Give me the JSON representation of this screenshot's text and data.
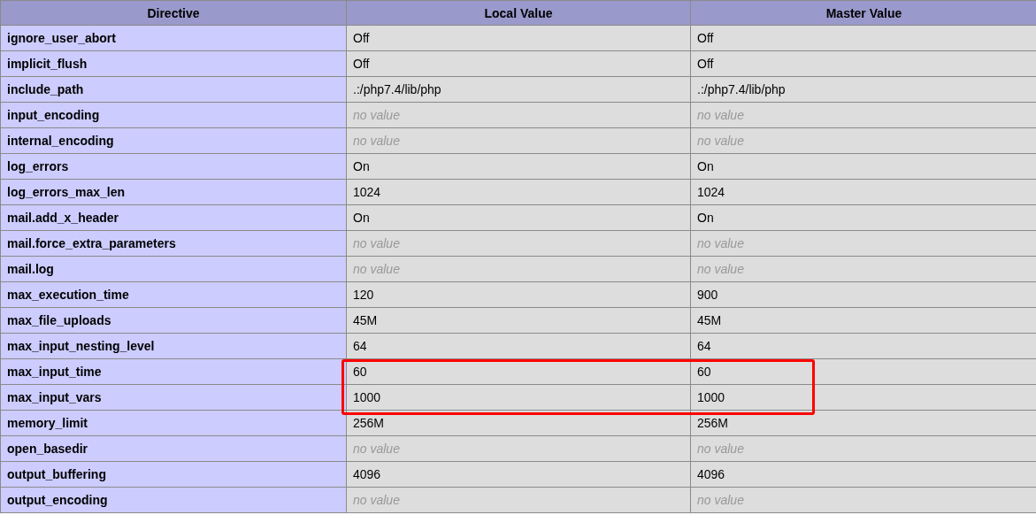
{
  "table": {
    "columns": [
      "Directive",
      "Local Value",
      "Master Value"
    ],
    "rows": [
      {
        "directive": "ignore_user_abort",
        "highlighted": false,
        "values": [
          {
            "text": "Off",
            "empty": false
          },
          {
            "text": "Off",
            "empty": false
          }
        ]
      },
      {
        "directive": "implicit_flush",
        "highlighted": false,
        "values": [
          {
            "text": "Off",
            "empty": false
          },
          {
            "text": "Off",
            "empty": false
          }
        ]
      },
      {
        "directive": "include_path",
        "highlighted": false,
        "values": [
          {
            "text": ".:/php7.4/lib/php",
            "empty": false
          },
          {
            "text": ".:/php7.4/lib/php",
            "empty": false
          }
        ]
      },
      {
        "directive": "input_encoding",
        "highlighted": false,
        "values": [
          {
            "text": "no value",
            "empty": true
          },
          {
            "text": "no value",
            "empty": true
          }
        ]
      },
      {
        "directive": "internal_encoding",
        "highlighted": false,
        "values": [
          {
            "text": "no value",
            "empty": true
          },
          {
            "text": "no value",
            "empty": true
          }
        ]
      },
      {
        "directive": "log_errors",
        "highlighted": false,
        "values": [
          {
            "text": "On",
            "empty": false
          },
          {
            "text": "On",
            "empty": false
          }
        ]
      },
      {
        "directive": "log_errors_max_len",
        "highlighted": false,
        "values": [
          {
            "text": "1024",
            "empty": false
          },
          {
            "text": "1024",
            "empty": false
          }
        ]
      },
      {
        "directive": "mail.add_x_header",
        "highlighted": false,
        "values": [
          {
            "text": "On",
            "empty": false
          },
          {
            "text": "On",
            "empty": false
          }
        ]
      },
      {
        "directive": "mail.force_extra_parameters",
        "highlighted": false,
        "values": [
          {
            "text": "no value",
            "empty": true
          },
          {
            "text": "no value",
            "empty": true
          }
        ]
      },
      {
        "directive": "mail.log",
        "highlighted": false,
        "values": [
          {
            "text": "no value",
            "empty": true
          },
          {
            "text": "no value",
            "empty": true
          }
        ]
      },
      {
        "directive": "max_execution_time",
        "highlighted": false,
        "values": [
          {
            "text": "120",
            "empty": false
          },
          {
            "text": "900",
            "empty": false
          }
        ]
      },
      {
        "directive": "max_file_uploads",
        "highlighted": false,
        "values": [
          {
            "text": "45M",
            "empty": false
          },
          {
            "text": "45M",
            "empty": false
          }
        ]
      },
      {
        "directive": "max_input_nesting_level",
        "highlighted": false,
        "values": [
          {
            "text": "64",
            "empty": false
          },
          {
            "text": "64",
            "empty": false
          }
        ]
      },
      {
        "directive": "max_input_time",
        "highlighted": true,
        "values": [
          {
            "text": "60",
            "empty": false
          },
          {
            "text": "60",
            "empty": false
          }
        ]
      },
      {
        "directive": "max_input_vars",
        "highlighted": true,
        "values": [
          {
            "text": "1000",
            "empty": false
          },
          {
            "text": "1000",
            "empty": false
          }
        ]
      },
      {
        "directive": "memory_limit",
        "highlighted": false,
        "values": [
          {
            "text": "256M",
            "empty": false
          },
          {
            "text": "256M",
            "empty": false
          }
        ]
      },
      {
        "directive": "open_basedir",
        "highlighted": false,
        "values": [
          {
            "text": "no value",
            "empty": true
          },
          {
            "text": "no value",
            "empty": true
          }
        ]
      },
      {
        "directive": "output_buffering",
        "highlighted": false,
        "values": [
          {
            "text": "4096",
            "empty": false
          },
          {
            "text": "4096",
            "empty": false
          }
        ]
      },
      {
        "directive": "output_encoding",
        "highlighted": false,
        "values": [
          {
            "text": "no value",
            "empty": true
          },
          {
            "text": "no value",
            "empty": true
          }
        ]
      }
    ]
  }
}
